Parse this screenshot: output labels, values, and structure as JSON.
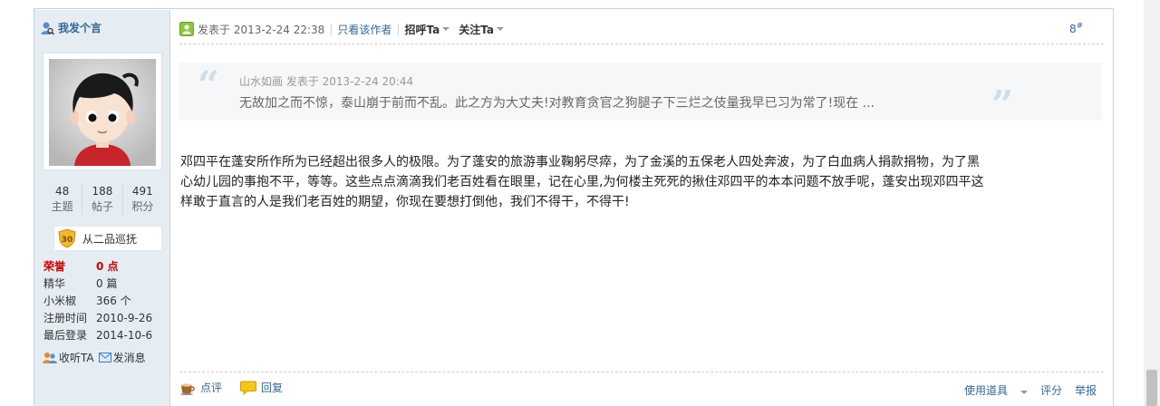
{
  "sidebar": {
    "author_link": "我发个言",
    "stats": [
      {
        "num": "48",
        "label": "主题"
      },
      {
        "num": "188",
        "label": "帖子"
      },
      {
        "num": "491",
        "label": "积分"
      }
    ],
    "rank": {
      "badge": "30",
      "title": "从二品巡抚"
    },
    "info": [
      {
        "key": "荣誉",
        "value": "0 点"
      },
      {
        "key": "精华",
        "value": "0 篇"
      },
      {
        "key": "小米椒",
        "value": "366 个"
      },
      {
        "key": "注册时间",
        "value": "2010-9-26"
      },
      {
        "key": "最后登录",
        "value": "2014-10-6"
      }
    ],
    "actions": {
      "follow": "收听TA",
      "message": "发消息"
    }
  },
  "post": {
    "posted_at": "发表于 2013-2-24 22:38",
    "only_author": "只看该作者",
    "greet": "招呼Ta",
    "follow": "关注Ta",
    "floor_num": "8",
    "floor_sym": "#",
    "quote": {
      "head": "山水如画 发表于 2013-2-24 20:44",
      "text": "无故加之而不惊，泰山崩于前而不乱。此之方为大丈夫!对教育贪官之狗腿子下三烂之伎量我早已习为常了!现在 ..."
    },
    "body_lines": [
      "邓四平在蓬安所作所为已经超出很多人的极限。为了蓬安的旅游事业鞠躬尽瘁，为了金溪的五保老人四处奔波，为了白血病人捐款捐物，为了黑",
      "心幼儿园的事抱不平，等等。这些点点滴滴我们老百姓看在眼里，记在心里,为何楼主死死的揪住邓四平的本本问题不放手呢，蓬安出现邓四平这",
      "样敢于直言的人是我们老百姓的期望，你现在要想打倒他，我们不得干，不得干!"
    ]
  },
  "footer": {
    "comment": "点评",
    "reply": "回复",
    "tools": "使用道具",
    "rate": "评分",
    "report": "举报"
  },
  "colors": {
    "link": "#336699",
    "sidebar_bg": "#e5edf2",
    "border": "#c2d5e3",
    "honor_red": "#cc0000"
  }
}
